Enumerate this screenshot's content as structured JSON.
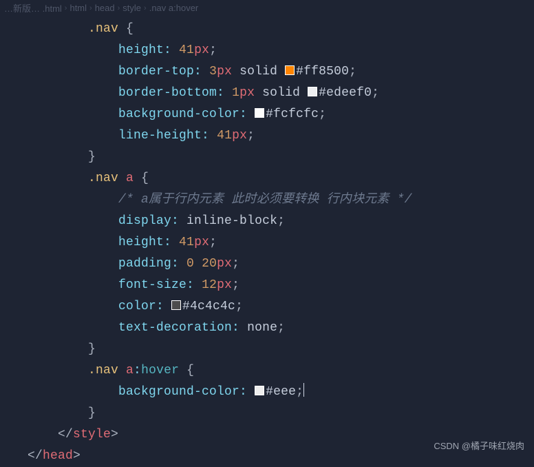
{
  "breadcrumb": {
    "file": "…新版… .html",
    "c1": "html",
    "c2": "head",
    "c3": "style",
    "c4": ".nav a:hover"
  },
  "code": {
    "r1_sel": ".nav",
    "r2_prop": "height",
    "r2_num": "41",
    "r2_unit": "px",
    "r3_prop": "border-top",
    "r3_num": "3",
    "r3_unit": "px",
    "r3_kw": "solid",
    "r3_hex": "#ff8500",
    "r4_prop": "border-bottom",
    "r4_num": "1",
    "r4_unit": "px",
    "r4_kw": "solid",
    "r4_hex": "#edeef0",
    "r5_prop": "background-color",
    "r5_hex": "#fcfcfc",
    "r6_prop": "line-height",
    "r6_num": "41",
    "r6_unit": "px",
    "r8_sel": ".nav",
    "r8_tag": "a",
    "r9_comment": "/* a属于行内元素 此时必须要转换 行内块元素 */",
    "r10_prop": "display",
    "r10_kw": "inline-block",
    "r11_prop": "height",
    "r11_num": "41",
    "r11_unit": "px",
    "r12_prop": "padding",
    "r12_n1": "0",
    "r12_n2": "20",
    "r12_unit": "px",
    "r13_prop": "font-size",
    "r13_num": "12",
    "r13_unit": "px",
    "r14_prop": "color",
    "r14_hex": "#4c4c4c",
    "r15_prop": "text-decoration",
    "r15_kw": "none",
    "r17_sel": ".nav",
    "r17_tag": "a",
    "r17_pseudo": "hover",
    "r18_prop": "background-color",
    "r18_hex": "#eee",
    "close_style": "style",
    "close_head": "head"
  },
  "swatches": {
    "r3": "#ff8500",
    "r4": "#edeef0",
    "r5": "#fcfcfc",
    "r14": "#4c4c4c",
    "r18": "#eeeeee"
  },
  "watermark": "CSDN @橘子味红烧肉"
}
